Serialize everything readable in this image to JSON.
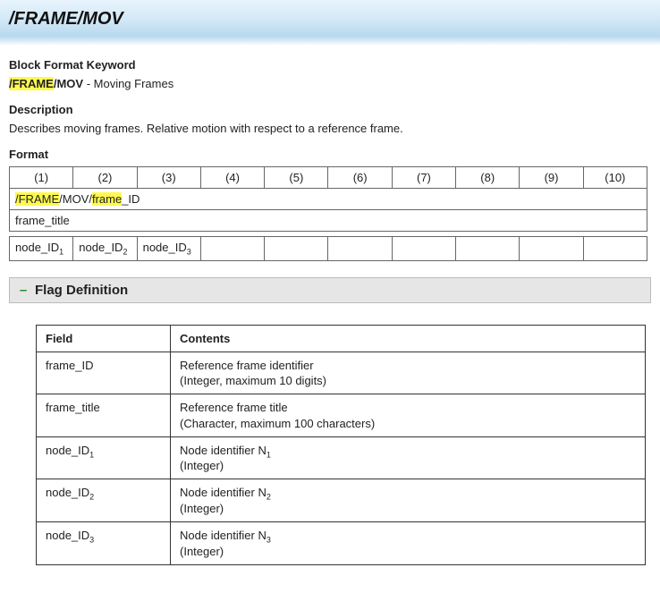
{
  "header": {
    "title": "/FRAME/MOV"
  },
  "sections": {
    "block_format_keyword_label": "Block Format Keyword",
    "keyword_hl1": "/FRAME",
    "keyword_plain": "/MOV",
    "keyword_desc": " - Moving Frames",
    "description_label": "Description",
    "description_text": "Describes moving frames.  Relative motion with respect to a reference frame.",
    "format_label": "Format"
  },
  "format_cols": [
    "(1)",
    "(2)",
    "(3)",
    "(4)",
    "(5)",
    "(6)",
    "(7)",
    "(8)",
    "(9)",
    "(10)"
  ],
  "format_rows": {
    "row1_hl1": "/FRAME",
    "row1_plain1": "/MOV/",
    "row1_hl2": "frame",
    "row1_plain2": "_ID",
    "row2": "frame_title",
    "row3": {
      "c1_base": "node_ID",
      "c1_sub": "1",
      "c2_base": "node_ID",
      "c2_sub": "2",
      "c3_base": "node_ID",
      "c3_sub": "3"
    }
  },
  "flag": {
    "toggle": "–",
    "title": "Flag Definition"
  },
  "def_headers": {
    "field": "Field",
    "contents": "Contents"
  },
  "defs": [
    {
      "field": "frame_ID",
      "field_sub": "",
      "line1": "Reference frame identifier",
      "line2": "(Integer, maximum 10 digits)",
      "nsub": ""
    },
    {
      "field": "frame_title",
      "field_sub": "",
      "line1": "Reference frame title",
      "line2": "(Character, maximum 100 characters)",
      "nsub": ""
    },
    {
      "field": "node_ID",
      "field_sub": "1",
      "line1": "Node identifier N",
      "line2": "(Integer)",
      "nsub": "1"
    },
    {
      "field": "node_ID",
      "field_sub": "2",
      "line1": "Node identifier N",
      "line2": "(Integer)",
      "nsub": "2"
    },
    {
      "field": "node_ID",
      "field_sub": "3",
      "line1": "Node identifier N",
      "line2": "(Integer)",
      "nsub": "3"
    }
  ]
}
